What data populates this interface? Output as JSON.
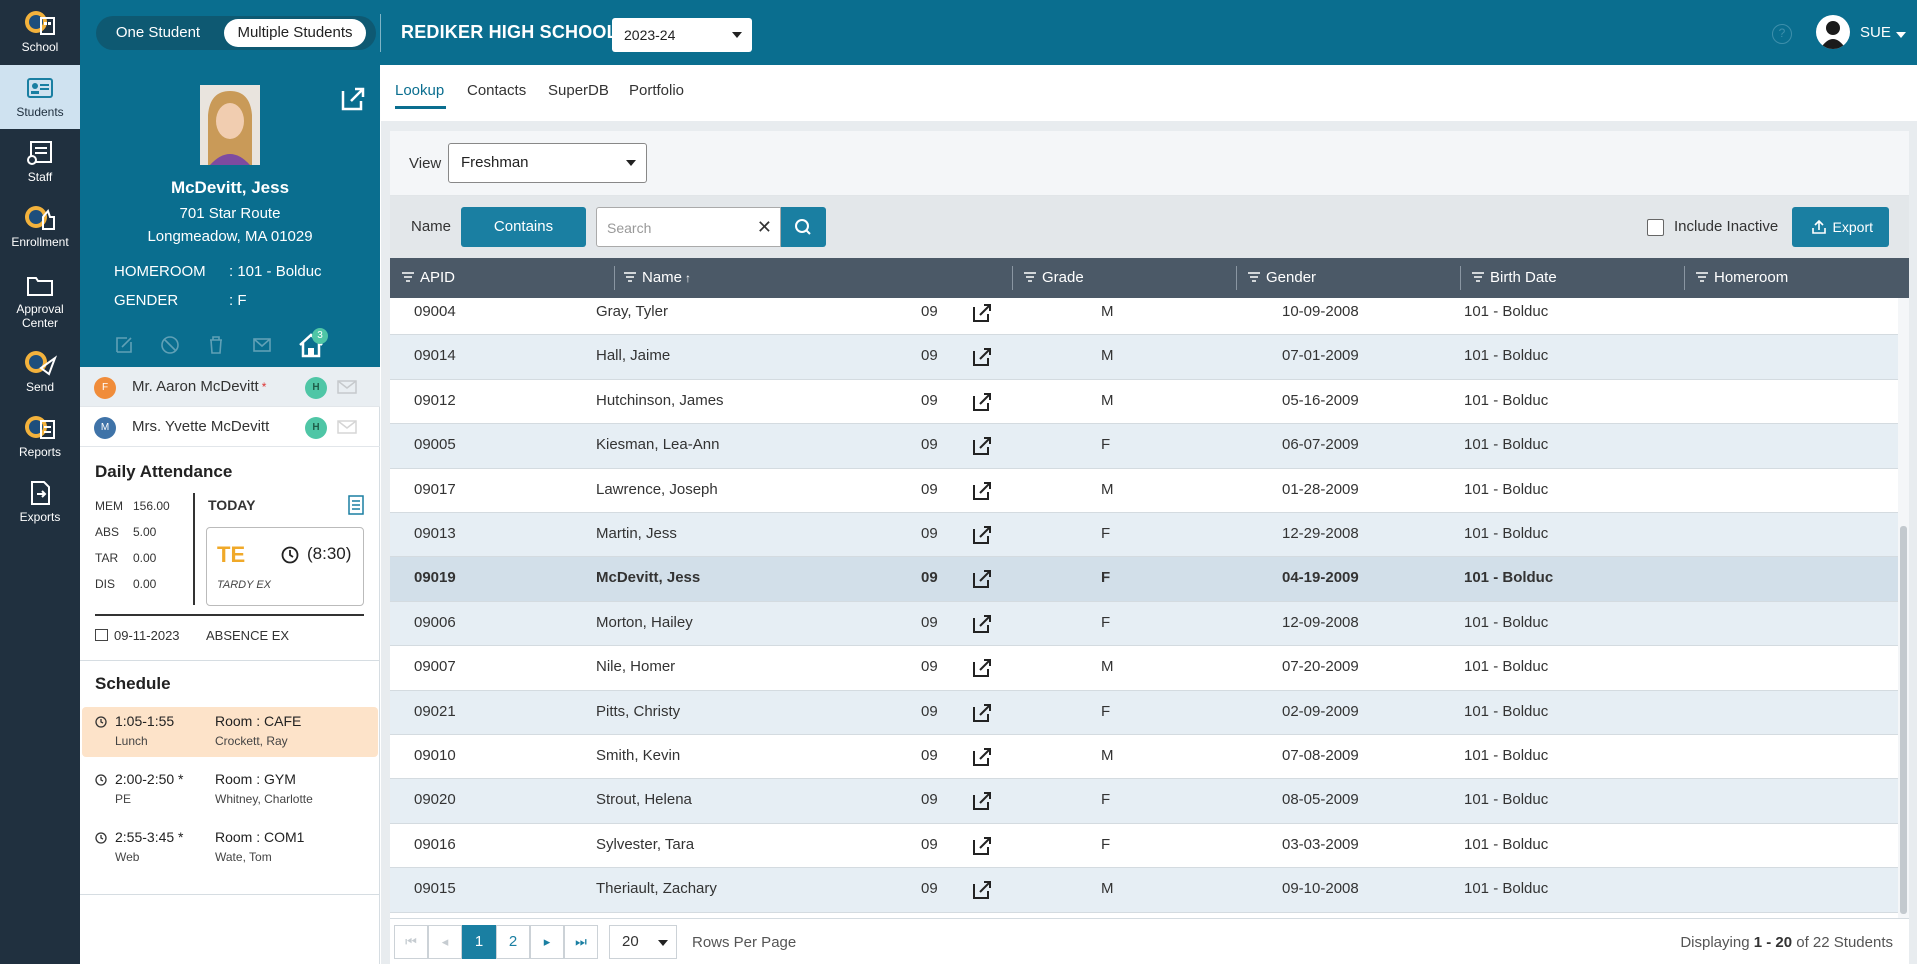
{
  "rail": [
    {
      "label": "School",
      "icon": "school-icon"
    },
    {
      "label": "Students",
      "icon": "students-icon",
      "active": true
    },
    {
      "label": "Staff",
      "icon": "staff-icon"
    },
    {
      "label": "Enrollment",
      "icon": "enrollment-icon"
    },
    {
      "label": "Approval",
      "label2": "Center",
      "icon": "approval-center-icon"
    },
    {
      "label": "Send",
      "icon": "send-icon"
    },
    {
      "label": "Reports",
      "icon": "reports-icon"
    },
    {
      "label": "Exports",
      "icon": "exports-icon"
    }
  ],
  "topbar": {
    "one_student": "One Student",
    "multiple_students": "Multiple Students",
    "school": "REDIKER HIGH SCHOOL",
    "year": "2023-24",
    "help": "?",
    "user": "SUE"
  },
  "student": {
    "name": "McDevitt, Jess",
    "address1": "701 Star Route",
    "address2": "Longmeadow, MA 01029",
    "homeroom_key": "HOMEROOM",
    "homeroom_val": ": 101 - Bolduc",
    "gender_key": "GENDER",
    "gender_val": ": F",
    "household_count": "3"
  },
  "contacts": [
    {
      "initial": "F",
      "name": "Mr. Aaron McDevitt",
      "required": "*",
      "badge": "H",
      "color": "#f08c3a"
    },
    {
      "initial": "M",
      "name": "Mrs. Yvette McDevitt",
      "required": "",
      "badge": "H",
      "color": "#3f73a8"
    }
  ],
  "attendance": {
    "title": "Daily Attendance",
    "rows": [
      {
        "k": "MEM",
        "v": "156.00"
      },
      {
        "k": "ABS",
        "v": "5.00"
      },
      {
        "k": "TAR",
        "v": "0.00"
      },
      {
        "k": "DIS",
        "v": "0.00"
      }
    ],
    "today_label": "TODAY",
    "code": "TE",
    "time": "(8:30)",
    "desc": "TARDY EX",
    "absence_date": "09-11-2023",
    "absence_type": "ABSENCE EX"
  },
  "schedule": {
    "title": "Schedule",
    "items": [
      {
        "time": "1:05-1:55",
        "subject": "Lunch",
        "room": "Room : CAFE",
        "teacher": "Crockett, Ray",
        "active": true
      },
      {
        "time": "2:00-2:50 *",
        "subject": "PE",
        "room": "Room : GYM",
        "teacher": "Whitney, Charlotte"
      },
      {
        "time": "2:55-3:45 *",
        "subject": "Web",
        "room": "Room : COM1",
        "teacher": "Wate, Tom"
      }
    ]
  },
  "tabs": [
    "Lookup",
    "Contacts",
    "SuperDB",
    "Portfolio"
  ],
  "filters": {
    "view_label": "View",
    "view_value": "Freshman",
    "name_label": "Name",
    "contains": "Contains",
    "search_placeholder": "Search",
    "include_inactive": "Include Inactive",
    "export": "Export"
  },
  "columns": [
    "APID",
    "Name",
    "Grade",
    "Gender",
    "Birth Date",
    "Homeroom"
  ],
  "rows": [
    [
      "09004",
      "Gray, Tyler",
      "09",
      "M",
      "10-09-2008",
      "101 - Bolduc"
    ],
    [
      "09014",
      "Hall, Jaime",
      "09",
      "M",
      "07-01-2009",
      "101 - Bolduc"
    ],
    [
      "09012",
      "Hutchinson, James",
      "09",
      "M",
      "05-16-2009",
      "101 - Bolduc"
    ],
    [
      "09005",
      "Kiesman, Lea-Ann",
      "09",
      "F",
      "06-07-2009",
      "101 - Bolduc"
    ],
    [
      "09017",
      "Lawrence, Joseph",
      "09",
      "M",
      "01-28-2009",
      "101 - Bolduc"
    ],
    [
      "09013",
      "Martin, Jess",
      "09",
      "F",
      "12-29-2008",
      "101 - Bolduc"
    ],
    [
      "09019",
      "McDevitt, Jess",
      "09",
      "F",
      "04-19-2009",
      "101 - Bolduc"
    ],
    [
      "09006",
      "Morton, Hailey",
      "09",
      "F",
      "12-09-2008",
      "101 - Bolduc"
    ],
    [
      "09007",
      "Nile, Homer",
      "09",
      "M",
      "07-20-2009",
      "101 - Bolduc"
    ],
    [
      "09021",
      "Pitts, Christy",
      "09",
      "F",
      "02-09-2009",
      "101 - Bolduc"
    ],
    [
      "09010",
      "Smith, Kevin",
      "09",
      "M",
      "07-08-2009",
      "101 - Bolduc"
    ],
    [
      "09020",
      "Strout, Helena",
      "09",
      "F",
      "08-05-2009",
      "101 - Bolduc"
    ],
    [
      "09016",
      "Sylvester, Tara",
      "09",
      "F",
      "03-03-2009",
      "101 - Bolduc"
    ],
    [
      "09015",
      "Theriault, Zachary",
      "09",
      "M",
      "09-10-2008",
      "101 - Bolduc"
    ]
  ],
  "selected_row": "09019",
  "pager": {
    "pages": [
      "1",
      "2"
    ],
    "current": "1",
    "rows_per_page": "20",
    "rows_label": "Rows Per Page",
    "displaying_prefix": "Displaying",
    "range": "1 - 20",
    "of_text": "of 22 Students"
  }
}
